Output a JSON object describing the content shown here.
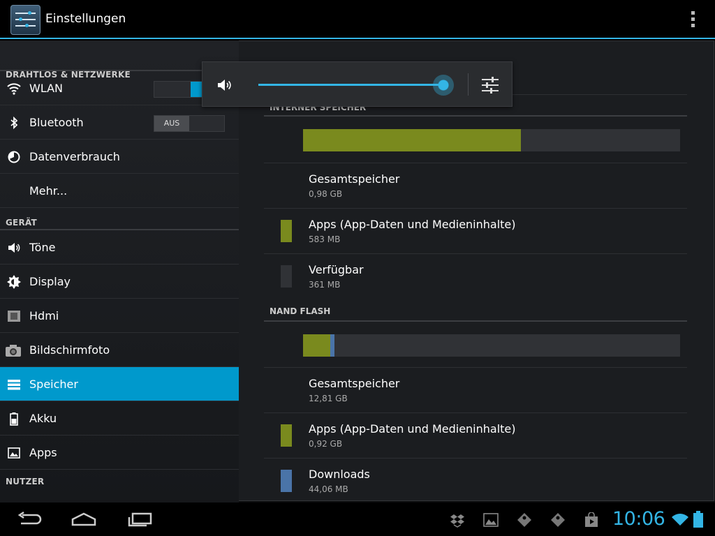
{
  "app": {
    "title": "Einstellungen",
    "icon": "settings-sliders-icon",
    "menu_icon": "overflow-menu-icon"
  },
  "colors": {
    "accent": "#33b5e5",
    "selected": "#0099cc",
    "apps_segment": "#7a8a1e",
    "downloads_segment": "#4a74a8",
    "free_segment": "#303236"
  },
  "sidebar": {
    "sections": [
      {
        "title": "DRAHTLOS & NETZWERKE",
        "items": [
          {
            "label": "WLAN",
            "icon": "wifi-icon",
            "toggle": "on"
          },
          {
            "label": "Bluetooth",
            "icon": "bluetooth-icon",
            "toggle": "off",
            "toggle_label": "AUS"
          },
          {
            "label": "Datenverbrauch",
            "icon": "data-usage-icon"
          },
          {
            "label": "Mehr...",
            "icon": ""
          }
        ]
      },
      {
        "title": "GERÄT",
        "items": [
          {
            "label": "Töne",
            "icon": "speaker-icon"
          },
          {
            "label": "Display",
            "icon": "brightness-icon"
          },
          {
            "label": "Hdmi",
            "icon": "hdmi-icon"
          },
          {
            "label": "Bildschirmfoto",
            "icon": "camera-icon"
          },
          {
            "label": "Speicher",
            "icon": "storage-icon",
            "selected": true
          },
          {
            "label": "Akku",
            "icon": "battery-icon"
          },
          {
            "label": "Apps",
            "icon": "apps-icon"
          }
        ]
      },
      {
        "title": "NUTZER",
        "items": []
      }
    ]
  },
  "storage": {
    "internal": {
      "title": "INTERNER SPEICHER",
      "usage_fraction": 0.578,
      "items": [
        {
          "title": "Gesamtspeicher",
          "value": "0,98 GB",
          "swatch": ""
        },
        {
          "title": "Apps (App-Daten und Medieninhalte)",
          "value": "583 MB",
          "swatch": "apps"
        },
        {
          "title": "Verfügbar",
          "value": "361 MB",
          "swatch": "free"
        }
      ]
    },
    "nand": {
      "title": "NAND FLASH",
      "apps_fraction": 0.072,
      "downloads_fraction": 0.011,
      "items": [
        {
          "title": "Gesamtspeicher",
          "value": "12,81 GB",
          "swatch": ""
        },
        {
          "title": "Apps (App-Daten und Medieninhalte)",
          "value": "0,92 GB",
          "swatch": "apps"
        },
        {
          "title": "Downloads",
          "value": "44,06 MB",
          "swatch": "downloads"
        }
      ]
    }
  },
  "volume_popup": {
    "icon": "speaker-icon",
    "level": 0.99,
    "settings_icon": "equalizer-settings-icon"
  },
  "system_bar": {
    "nav": [
      "back-icon",
      "home-icon",
      "recent-apps-icon"
    ],
    "notifications": [
      "dropbox-icon",
      "gallery-icon",
      "puzzle-icon",
      "puzzle-icon",
      "store-icon"
    ],
    "clock": "10:06",
    "status": [
      "wifi-icon",
      "battery-icon"
    ]
  }
}
